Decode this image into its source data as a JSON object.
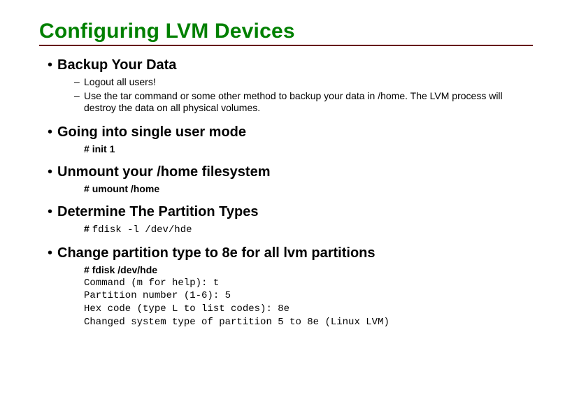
{
  "title": "Configuring LVM Devices",
  "bullets": {
    "backup": {
      "label": "Backup Your Data",
      "sub1": "Logout all users!",
      "sub2": "Use the tar command or some other method to backup your data in /home. The LVM process will destroy the data on all physical volumes."
    },
    "single": {
      "label": "Going into single user mode",
      "hash": "#",
      "cmd": "init 1"
    },
    "unmount": {
      "label": "Unmount your /home filesystem",
      "hash": "#",
      "cmd": "umount /home"
    },
    "determine": {
      "label": "Determine The Partition Types",
      "hash": "#",
      "cmd": "fdisk -l /dev/hde"
    },
    "change": {
      "label": "Change partition type to 8e for all lvm partitions",
      "hash": "#",
      "cmd": "fdisk /dev/hde",
      "out1": "Command (m for help): t",
      "out2": "Partition number (1-6): 5",
      "out3": "Hex code (type L to list codes): 8e",
      "out4": "Changed system type of partition 5 to 8e (Linux LVM)"
    }
  }
}
